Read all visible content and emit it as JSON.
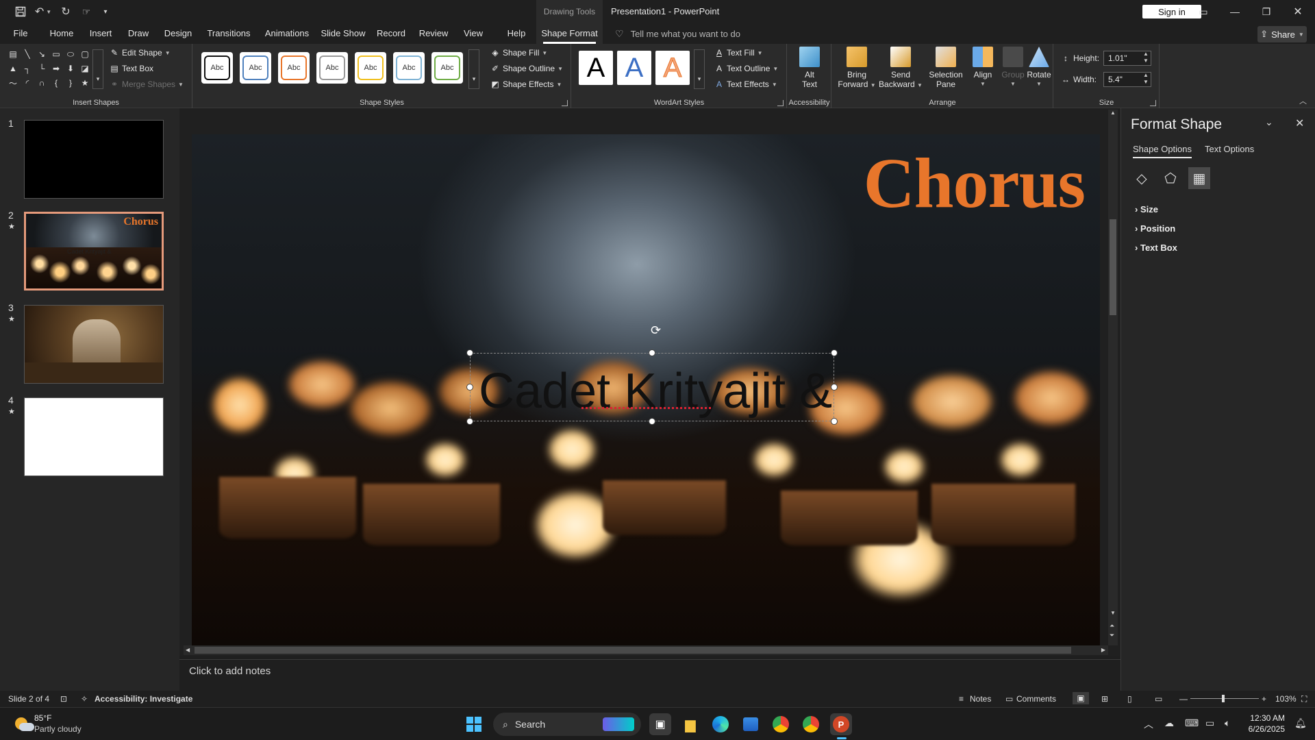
{
  "titlebar": {
    "context_tab": "Drawing Tools",
    "doc_title": "Presentation1  -  PowerPoint",
    "sign_in": "Sign in"
  },
  "tabs": [
    "File",
    "Home",
    "Insert",
    "Draw",
    "Design",
    "Transitions",
    "Animations",
    "Slide Show",
    "Record",
    "Review",
    "View",
    "Help",
    "Shape Format"
  ],
  "active_tab": "Shape Format",
  "tell_me": "Tell me what you want to do",
  "share": "Share",
  "ribbon": {
    "insert_shapes": {
      "label": "Insert Shapes",
      "edit_shape": "Edit Shape",
      "text_box": "Text Box",
      "merge_shapes": "Merge Shapes"
    },
    "shape_styles": {
      "label": "Shape Styles",
      "swatch_text": "Abc",
      "shape_fill": "Shape Fill",
      "shape_outline": "Shape Outline",
      "shape_effects": "Shape Effects"
    },
    "wordart": {
      "label": "WordArt Styles",
      "letter": "A",
      "text_fill": "Text Fill",
      "text_outline": "Text Outline",
      "text_effects": "Text Effects"
    },
    "accessibility": {
      "label": "Accessibility",
      "alt_text_1": "Alt",
      "alt_text_2": "Text"
    },
    "arrange": {
      "label": "Arrange",
      "bring_1": "Bring",
      "bring_2": "Forward",
      "send_1": "Send",
      "send_2": "Backward",
      "sel_1": "Selection",
      "sel_2": "Pane",
      "align": "Align",
      "group": "Group",
      "rotate": "Rotate"
    },
    "size": {
      "label": "Size",
      "height_label": "Height:",
      "height": "1.01\"",
      "width_label": "Width:",
      "width": "5.4\""
    }
  },
  "thumbnails": [
    {
      "num": "1",
      "star": ""
    },
    {
      "num": "2",
      "star": "★",
      "title": "Chorus",
      "text": "Cadet Krityajit &"
    },
    {
      "num": "3",
      "star": "★"
    },
    {
      "num": "4",
      "star": "★"
    }
  ],
  "slide": {
    "title": "Chorus",
    "textbox": "Cadet Krityajit &"
  },
  "notes_placeholder": "Click to add notes",
  "pane": {
    "title": "Format Shape",
    "tab_shape": "Shape Options",
    "tab_text": "Text Options",
    "sections": [
      "Size",
      "Position",
      "Text Box"
    ]
  },
  "status": {
    "slide": "Slide 2 of 4",
    "accessibility": "Accessibility: Investigate",
    "notes": "Notes",
    "comments": "Comments",
    "zoom": "103%"
  },
  "taskbar": {
    "weather_temp": "85°F",
    "weather_desc": "Partly cloudy",
    "search": "Search",
    "time": "12:30 AM",
    "date": "6/26/2025"
  },
  "colors": {
    "accent_orange": "#e8762b",
    "thumb_select": "#e59a7b"
  }
}
